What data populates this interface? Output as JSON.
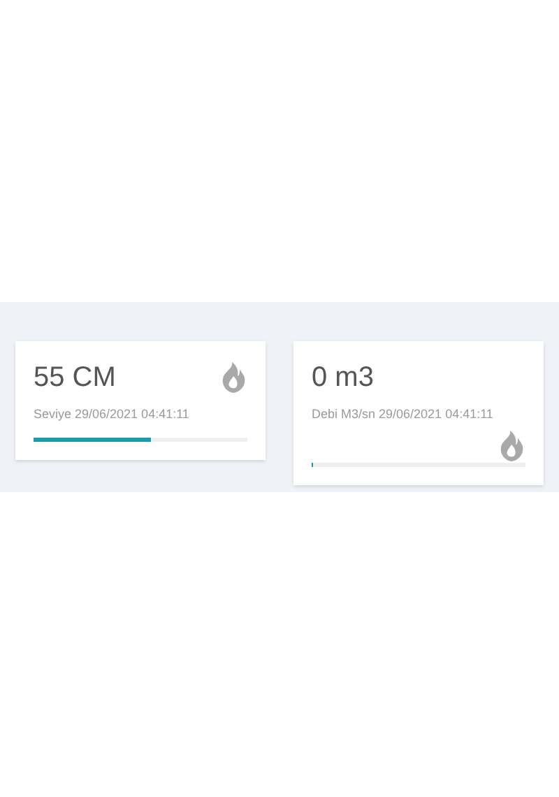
{
  "cards": [
    {
      "kind": "icon-top",
      "value": "55 CM",
      "caption": "Seviye 29/06/2021 04:41:11",
      "level": 0.55
    },
    {
      "kind": "icon-bottom",
      "value": "0 m3",
      "caption": "Debi M3/sn 29/06/2021 04:41:11",
      "level": 0
    }
  ]
}
